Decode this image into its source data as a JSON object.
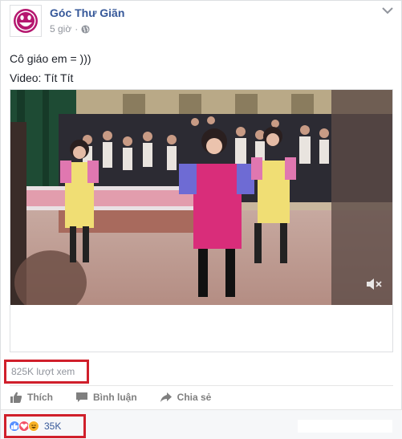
{
  "post": {
    "page_name": "Góc Thư Giãn",
    "time": "5 giờ",
    "lines": [
      "Cô giáo em = )))",
      "Video: Tít Tít"
    ],
    "views": "825K lượt xem",
    "actions": {
      "like": "Thích",
      "comment": "Bình luận",
      "share": "Chia sẻ"
    },
    "reactions_count": "35K",
    "icons": {
      "avatar": "smiley-face-logo",
      "privacy": "globe-icon",
      "menu": "chevron-down-icon",
      "mute": "muted-speaker-icon",
      "like": "thumbs-up-icon",
      "comment": "comment-bubble-icon",
      "share": "share-arrow-icon",
      "reaction_types": [
        "like",
        "love",
        "haha"
      ]
    },
    "colors": {
      "brand_link": "#365899",
      "meta": "#90949c",
      "highlight": "#d01f2b",
      "avatar": "#b5176f"
    }
  }
}
